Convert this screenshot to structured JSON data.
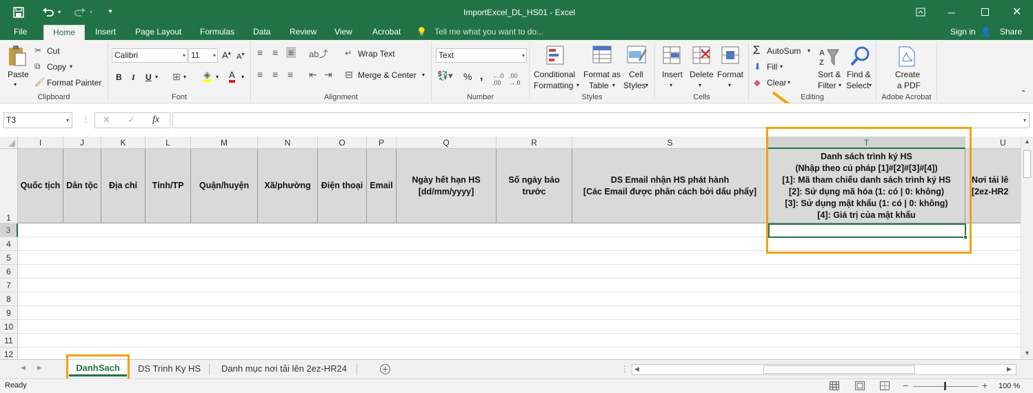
{
  "window": {
    "title": "ImportExcel_DL_HS01 - Excel",
    "sign_in": "Sign in",
    "share": "Share"
  },
  "ribbon_tabs": [
    "File",
    "Home",
    "Insert",
    "Page Layout",
    "Formulas",
    "Data",
    "Review",
    "View",
    "Acrobat"
  ],
  "tell_me": "Tell me what you want to do...",
  "clipboard": {
    "paste": "Paste",
    "cut": "Cut",
    "copy": "Copy",
    "format_painter": "Format Painter",
    "label": "Clipboard"
  },
  "font": {
    "name": "Calibri",
    "size": "11",
    "label": "Font"
  },
  "alignment": {
    "wrap": "Wrap Text",
    "merge": "Merge & Center",
    "label": "Alignment"
  },
  "number": {
    "format": "Text",
    "label": "Number"
  },
  "styles": {
    "conditional": "Conditional",
    "formatting": "Formatting",
    "format_as": "Format as",
    "table": "Table",
    "cell": "Cell",
    "cell_styles": "Styles",
    "label": "Styles"
  },
  "cells": {
    "insert": "Insert",
    "delete": "Delete",
    "format": "Format",
    "label": "Cells"
  },
  "editing": {
    "autosum": "AutoSum",
    "fill": "Fill",
    "clear": "Clear",
    "sort1": "Sort &",
    "sort2": "Filter",
    "find1": "Find &",
    "find2": "Select",
    "label": "Editing"
  },
  "acrobat": {
    "create1": "Create",
    "create2": "a PDF",
    "label": "Adobe Acrobat"
  },
  "formula_bar": {
    "name_box": "T3",
    "fx": "fx",
    "value": ""
  },
  "columns": [
    "I",
    "J",
    "K",
    "L",
    "M",
    "N",
    "O",
    "P",
    "Q",
    "R",
    "S",
    "T",
    "U"
  ],
  "header_cells": {
    "I": "Quốc tịch",
    "J": "Dân tộc",
    "K": "Địa chỉ",
    "L": "Tỉnh/TP",
    "M": "Quận/huyện",
    "N": "Xã/phường",
    "O": "Điện thoại",
    "P": "Email",
    "Q": "Ngày hết hạn HS\n[dd/mm/yyyy]",
    "R": "Số ngày báo\ntrước",
    "S": "DS Email nhận HS phát hành\n[Các Email được phân cách bởi dấu phẩy]",
    "T": "Danh sách trình ký HS\n(Nhập theo cú pháp [1]#[2]#[3]#[4])\n[1]: Mã tham chiếu danh sách trình ký HS\n[2]: Sử dụng mã hóa (1: có | 0: không)\n[3]: Sử dụng mật khẩu (1: có | 0: không)\n[4]: Giá trị của mật khẩu",
    "U": "Nơi tải lê\n[2ez-HR2"
  },
  "rows": [
    "1",
    "3",
    "4",
    "5",
    "6",
    "7",
    "8",
    "9",
    "10",
    "11",
    "12"
  ],
  "sheet_tabs": [
    "DanhSach",
    "DS Trinh Ky HS",
    "Danh mục nơi tải lên 2ez-HR24"
  ],
  "status": {
    "ready": "Ready",
    "zoom": "100 %"
  },
  "colors": {
    "excel_green": "#217346",
    "highlight": "#f0a30a"
  }
}
